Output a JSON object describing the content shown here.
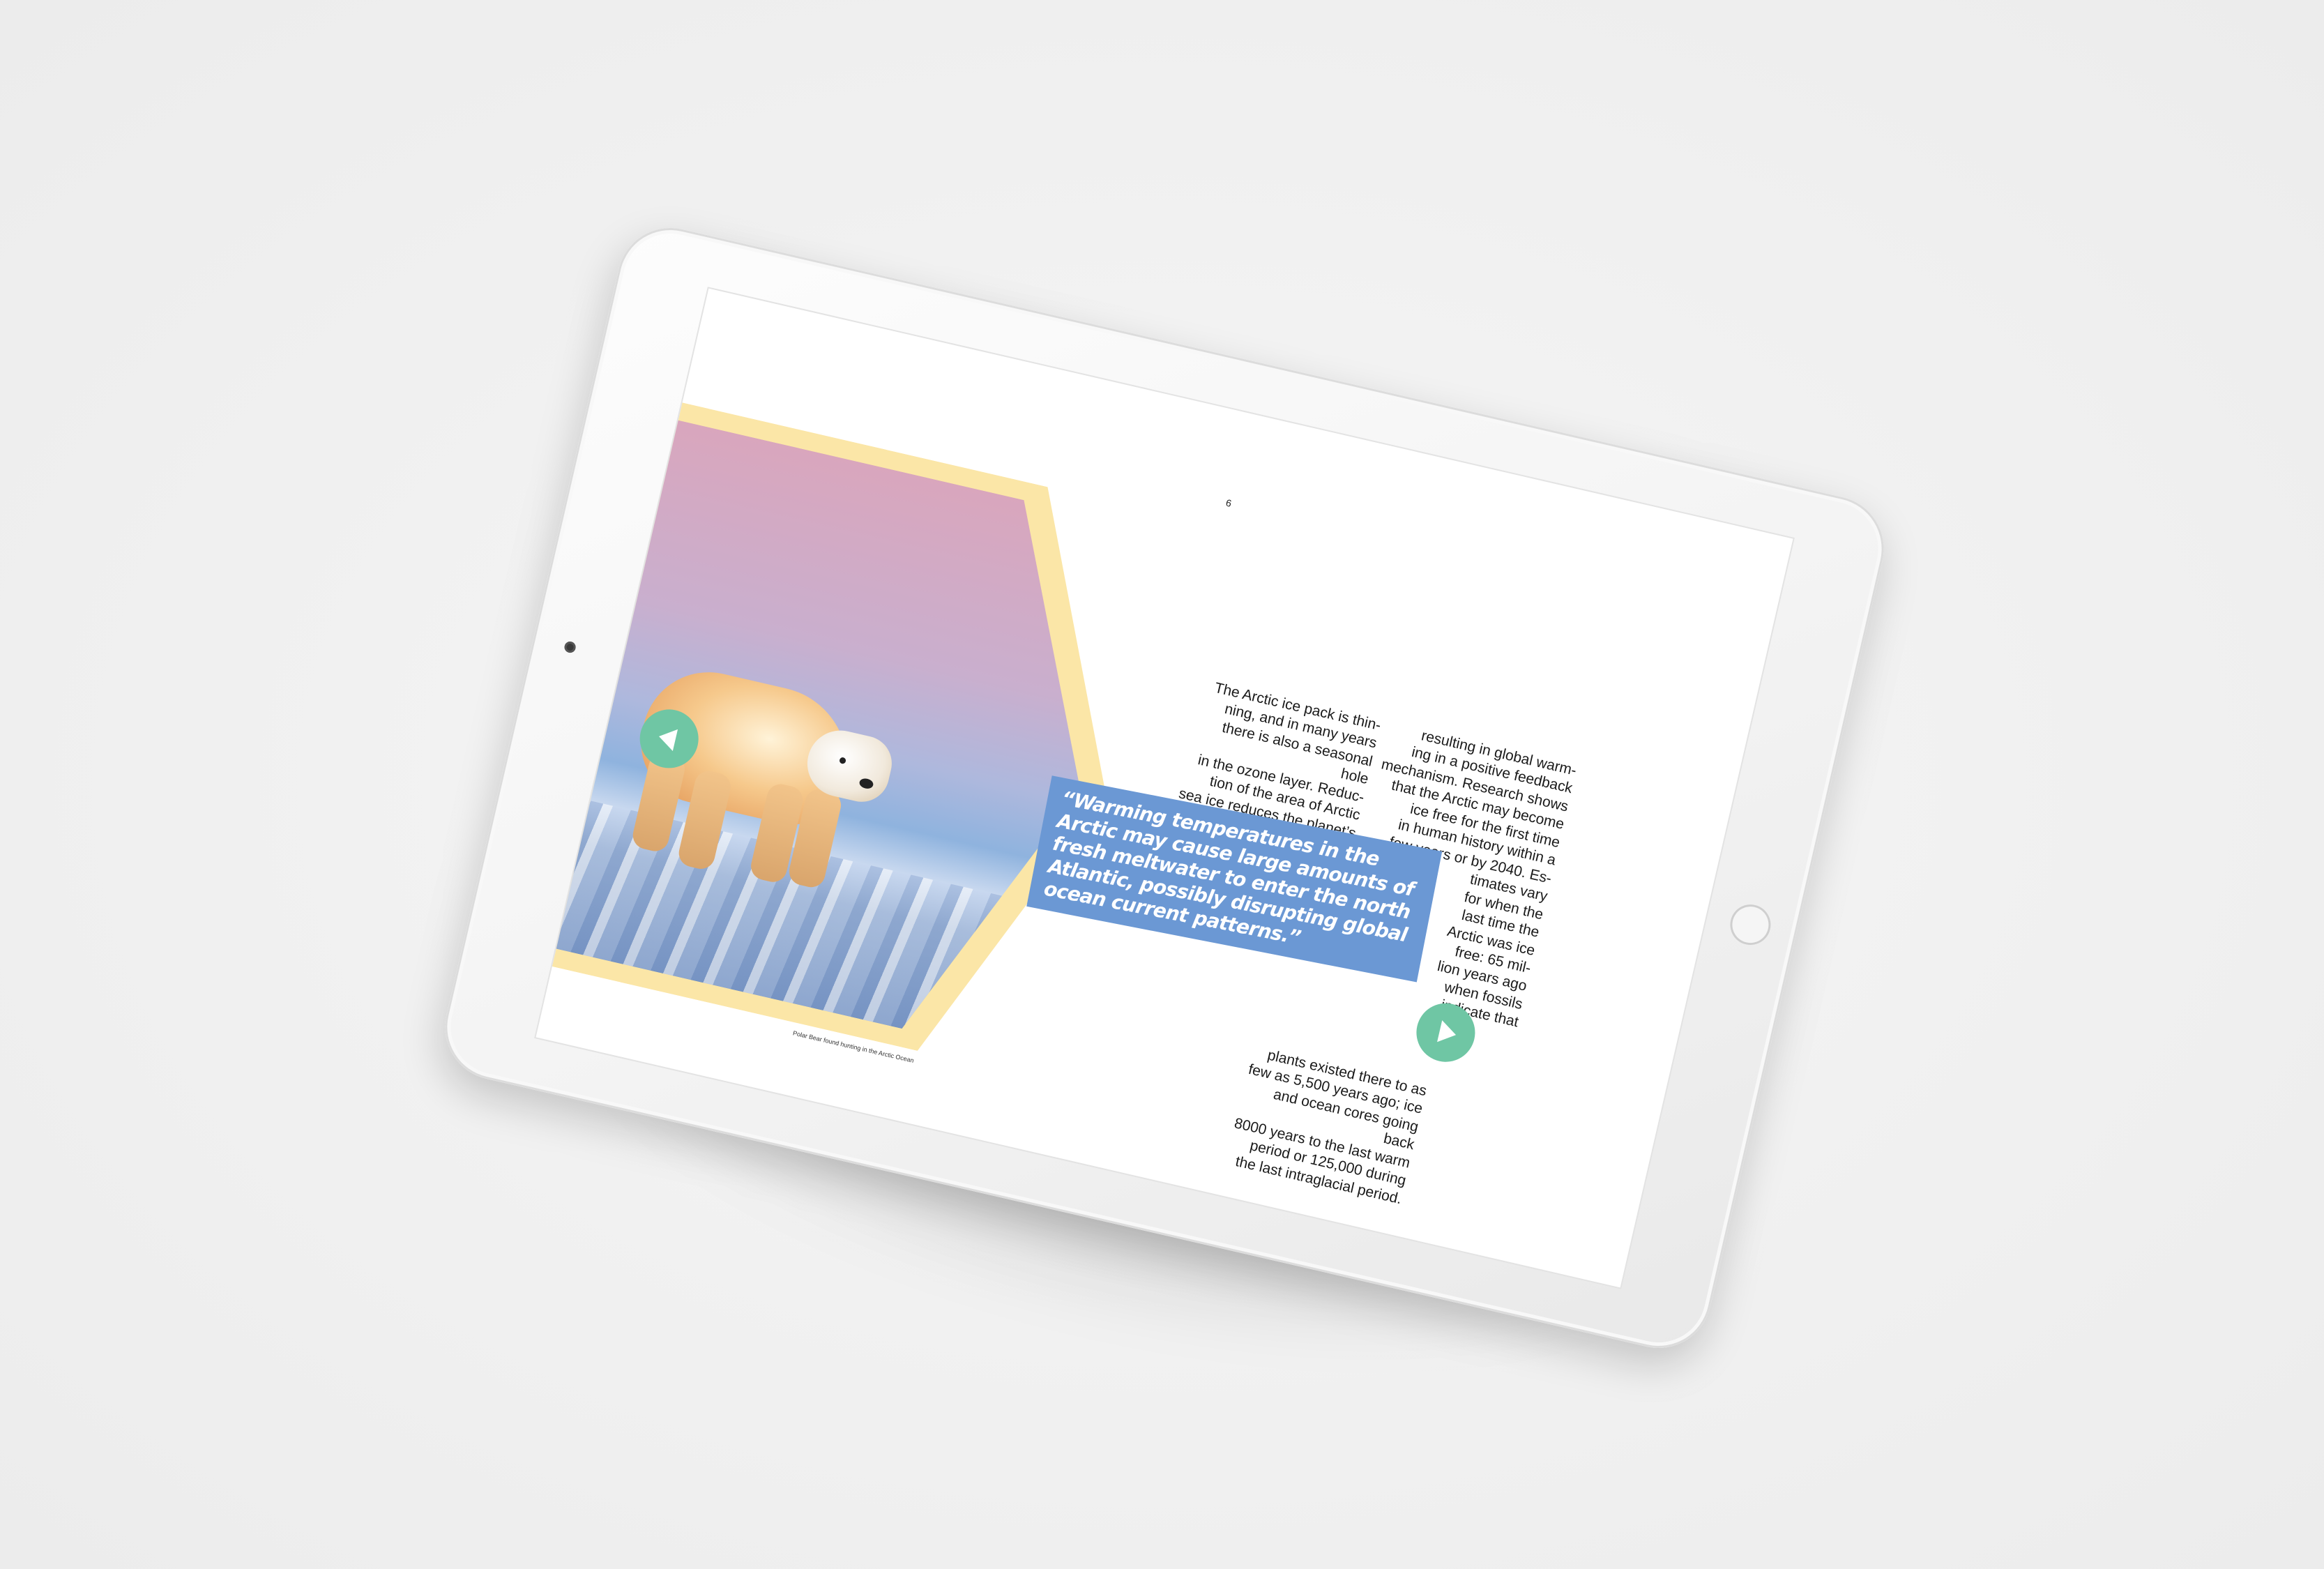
{
  "page": {
    "number": "6"
  },
  "photo": {
    "caption": "Polar Bear found hunting in the Arctic Ocean"
  },
  "pull_quote": "“Warming temperatures in the Arctic may cause large amounts of fresh meltwater to enter the north Atlantic, possibly disrupting global ocean current patterns.”",
  "article": {
    "column_1": "The Arctic ice pack is thin-\nning, and in many years\nthere is also a seasonal hole\nin the ozone layer. Reduc-\ntion of the area of Arctic\nsea ice reduces the planet’s\naverage albedo, possibly",
    "column_2": "resulting in global warm-\ning in a positive feedback\nmechanism. Research shows\nthat the Arctic may become\nice free for the first time\nin human history within a\nfew years or by 2040. Es-\ntimates vary\nfor when the\nlast time the\nArctic was ice\nfree: 65 mil-\nlion years ago\nwhen fossils\nindicate that",
    "column_3": "plants existed there to as\nfew as 5,500 years ago; ice\nand ocean cores going back\n8000 years to the last warm\nperiod or 125,000 during\nthe last intraglacial period."
  },
  "navigation": {
    "prev_icon": "chevron-left-icon",
    "next_icon": "chevron-right-icon"
  },
  "colors": {
    "accent_green": "#6fc6a4",
    "quote_blue": "#6b98d4",
    "frame_yellow": "#fbe6a7"
  }
}
